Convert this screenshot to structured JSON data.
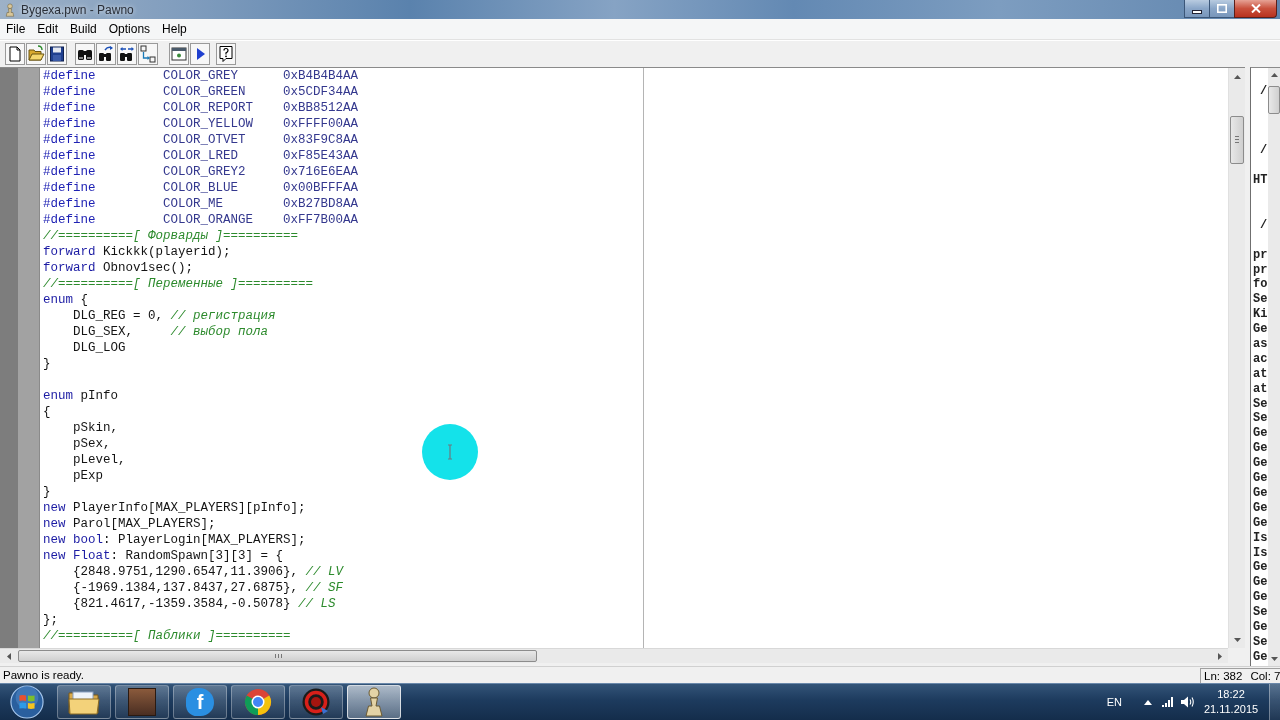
{
  "window": {
    "title": "Bygexa.pwn - Pawno"
  },
  "menu": [
    "File",
    "Edit",
    "Build",
    "Options",
    "Help"
  ],
  "editor": {
    "lines": [
      {
        "kind": "code",
        "tokens": [
          {
            "kind": "preproc",
            "text": "#define         "
          },
          {
            "kind": "constant",
            "text": "COLOR_GREY      0xB4B4B4AA"
          }
        ]
      },
      {
        "kind": "code",
        "tokens": [
          {
            "kind": "preproc",
            "text": "#define         "
          },
          {
            "kind": "constant",
            "text": "COLOR_GREEN     0x5CDF34AA"
          }
        ]
      },
      {
        "kind": "code",
        "tokens": [
          {
            "kind": "preproc",
            "text": "#define         "
          },
          {
            "kind": "constant",
            "text": "COLOR_REPORT    0xBB8512AA"
          }
        ]
      },
      {
        "kind": "code",
        "tokens": [
          {
            "kind": "preproc",
            "text": "#define         "
          },
          {
            "kind": "constant",
            "text": "COLOR_YELLOW    0xFFFF00AA"
          }
        ]
      },
      {
        "kind": "code",
        "tokens": [
          {
            "kind": "preproc",
            "text": "#define         "
          },
          {
            "kind": "constant",
            "text": "COLOR_OTVET     0x83F9C8AA"
          }
        ]
      },
      {
        "kind": "code",
        "tokens": [
          {
            "kind": "preproc",
            "text": "#define         "
          },
          {
            "kind": "constant",
            "text": "COLOR_LRED      0xF85E43AA"
          }
        ]
      },
      {
        "kind": "code",
        "tokens": [
          {
            "kind": "preproc",
            "text": "#define         "
          },
          {
            "kind": "constant",
            "text": "COLOR_GREY2     0x716E6EAA"
          }
        ]
      },
      {
        "kind": "code",
        "tokens": [
          {
            "kind": "preproc",
            "text": "#define         "
          },
          {
            "kind": "constant",
            "text": "COLOR_BLUE      0x00BFFFAA"
          }
        ]
      },
      {
        "kind": "code",
        "tokens": [
          {
            "kind": "preproc",
            "text": "#define         "
          },
          {
            "kind": "constant",
            "text": "COLOR_ME        0xB27BD8AA"
          }
        ]
      },
      {
        "kind": "code",
        "tokens": [
          {
            "kind": "preproc",
            "text": "#define         "
          },
          {
            "kind": "constant",
            "text": "COLOR_ORANGE    0xFF7B00AA"
          }
        ]
      },
      {
        "kind": "code",
        "tokens": [
          {
            "kind": "comment",
            "text": "//==========[ Форварды ]=========="
          }
        ]
      },
      {
        "kind": "code",
        "tokens": [
          {
            "kind": "keyword",
            "text": "forward "
          },
          {
            "kind": "plain",
            "text": "Kickkk(playerid);"
          }
        ]
      },
      {
        "kind": "code",
        "tokens": [
          {
            "kind": "keyword",
            "text": "forward "
          },
          {
            "kind": "plain",
            "text": "Obnov1sec();"
          }
        ]
      },
      {
        "kind": "code",
        "tokens": [
          {
            "kind": "comment",
            "text": "//==========[ Переменные ]=========="
          }
        ]
      },
      {
        "kind": "code",
        "tokens": [
          {
            "kind": "keyword",
            "text": "enum "
          },
          {
            "kind": "plain",
            "text": "{"
          }
        ]
      },
      {
        "kind": "code",
        "tokens": [
          {
            "kind": "plain",
            "text": "    DLG_REG = 0, "
          },
          {
            "kind": "comment",
            "text": "// регистрация"
          }
        ]
      },
      {
        "kind": "code",
        "tokens": [
          {
            "kind": "plain",
            "text": "    DLG_SEX,     "
          },
          {
            "kind": "comment",
            "text": "// выбор пола"
          }
        ]
      },
      {
        "kind": "code",
        "tokens": [
          {
            "kind": "plain",
            "text": "    DLG_LOG"
          }
        ]
      },
      {
        "kind": "code",
        "tokens": [
          {
            "kind": "plain",
            "text": "}"
          }
        ]
      },
      {
        "kind": "blank"
      },
      {
        "kind": "code",
        "tokens": [
          {
            "kind": "keyword",
            "text": "enum "
          },
          {
            "kind": "plain",
            "text": "pInfo"
          }
        ]
      },
      {
        "kind": "code",
        "tokens": [
          {
            "kind": "plain",
            "text": "{"
          }
        ]
      },
      {
        "kind": "code",
        "tokens": [
          {
            "kind": "plain",
            "text": "    pSkin,"
          }
        ]
      },
      {
        "kind": "code",
        "tokens": [
          {
            "kind": "plain",
            "text": "    pSex,"
          }
        ]
      },
      {
        "kind": "code",
        "tokens": [
          {
            "kind": "plain",
            "text": "    pLevel,"
          }
        ]
      },
      {
        "kind": "code",
        "tokens": [
          {
            "kind": "plain",
            "text": "    pExp"
          }
        ]
      },
      {
        "kind": "code",
        "tokens": [
          {
            "kind": "plain",
            "text": "}"
          }
        ]
      },
      {
        "kind": "code",
        "tokens": [
          {
            "kind": "keyword",
            "text": "new "
          },
          {
            "kind": "plain",
            "text": "PlayerInfo[MAX_PLAYERS][pInfo];"
          }
        ]
      },
      {
        "kind": "code",
        "tokens": [
          {
            "kind": "keyword",
            "text": "new "
          },
          {
            "kind": "plain",
            "text": "Parol[MAX_PLAYERS];"
          }
        ]
      },
      {
        "kind": "code",
        "tokens": [
          {
            "kind": "keyword",
            "text": "new bool"
          },
          {
            "kind": "plain",
            "text": ": PlayerLogin[MAX_PLAYERS];"
          }
        ]
      },
      {
        "kind": "code",
        "tokens": [
          {
            "kind": "keyword",
            "text": "new Float"
          },
          {
            "kind": "plain",
            "text": ": RandomSpawn[3][3] = {"
          }
        ]
      },
      {
        "kind": "code",
        "tokens": [
          {
            "kind": "plain",
            "text": "    {2848.9751,1290.6547,11.3906}, "
          },
          {
            "kind": "comment",
            "text": "// LV"
          }
        ]
      },
      {
        "kind": "code",
        "tokens": [
          {
            "kind": "plain",
            "text": "    {-1969.1384,137.8437,27.6875}, "
          },
          {
            "kind": "comment",
            "text": "// SF"
          }
        ]
      },
      {
        "kind": "code",
        "tokens": [
          {
            "kind": "plain",
            "text": "    {821.4617,-1359.3584,-0.5078} "
          },
          {
            "kind": "comment",
            "text": "// LS"
          }
        ]
      },
      {
        "kind": "code",
        "tokens": [
          {
            "kind": "plain",
            "text": "};"
          }
        ]
      },
      {
        "kind": "code",
        "tokens": [
          {
            "kind": "comment",
            "text": "//==========[ Паблики ]=========="
          }
        ]
      }
    ]
  },
  "function_list": {
    "rows": [
      {
        "kind": "blank"
      },
      {
        "kind": "header",
        "text": "/"
      },
      {
        "kind": "blank"
      },
      {
        "kind": "blank"
      },
      {
        "kind": "blank"
      },
      {
        "kind": "header",
        "text": "/"
      },
      {
        "kind": "blank"
      },
      {
        "kind": "item",
        "text": "HT"
      },
      {
        "kind": "blank"
      },
      {
        "kind": "blank"
      },
      {
        "kind": "header",
        "text": "/"
      },
      {
        "kind": "blank"
      },
      {
        "kind": "item",
        "text": "pr"
      },
      {
        "kind": "item",
        "text": "pr"
      },
      {
        "kind": "item",
        "text": "fo"
      },
      {
        "kind": "item",
        "text": "Se"
      },
      {
        "kind": "item",
        "text": "Ki"
      },
      {
        "kind": "item",
        "text": "Ge"
      },
      {
        "kind": "item",
        "text": "as"
      },
      {
        "kind": "item",
        "text": "ac"
      },
      {
        "kind": "item",
        "text": "at"
      },
      {
        "kind": "item",
        "text": "at"
      },
      {
        "kind": "item",
        "text": "Se"
      },
      {
        "kind": "item",
        "text": "Se"
      },
      {
        "kind": "item",
        "text": "Ge"
      },
      {
        "kind": "item",
        "text": "Ge"
      },
      {
        "kind": "item",
        "text": "Ge"
      },
      {
        "kind": "item",
        "text": "Ge"
      },
      {
        "kind": "item",
        "text": "Ge"
      },
      {
        "kind": "item",
        "text": "Ge"
      },
      {
        "kind": "item",
        "text": "Ge"
      },
      {
        "kind": "item",
        "text": "Is"
      },
      {
        "kind": "item",
        "text": "Is"
      },
      {
        "kind": "item",
        "text": "Ge"
      },
      {
        "kind": "item",
        "text": "Ge"
      },
      {
        "kind": "item",
        "text": "Ge"
      },
      {
        "kind": "item",
        "text": "Se"
      },
      {
        "kind": "item",
        "text": "Ge"
      },
      {
        "kind": "item",
        "text": "Se"
      },
      {
        "kind": "item",
        "text": "Ge"
      }
    ]
  },
  "status_bar": {
    "message": "Pawno is ready.",
    "line": "Ln: 382",
    "column": "Col: 7"
  },
  "taskbar": {
    "apps": [
      {
        "kind": "folder",
        "selected": false
      },
      {
        "kind": "photo",
        "selected": false
      },
      {
        "kind": "splash",
        "glyph": "f",
        "selected": false
      },
      {
        "kind": "browser",
        "selected": false
      },
      {
        "kind": "record",
        "selected": false
      },
      {
        "kind": "pawn",
        "selected": true
      }
    ],
    "language": "EN",
    "time": "18:22",
    "date": "21.11.2015"
  }
}
